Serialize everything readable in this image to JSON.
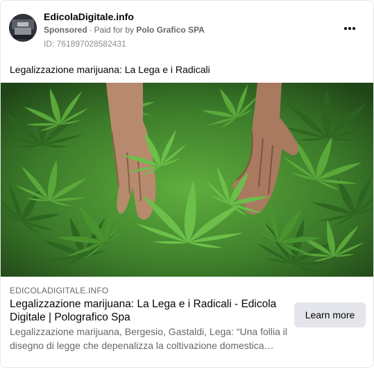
{
  "post": {
    "page_name": "EdicolaDigitale.info",
    "sponsored_label": "Sponsored",
    "paid_for_prefix": "Paid for by",
    "paid_for_by": "Polo Grafico SPA",
    "ad_id": "ID: 761897028582431",
    "body_text": "Legalizzazione marijuana: La Lega e i Radicali",
    "more_icon": "more-dots-icon"
  },
  "link_preview": {
    "domain": "EDICOLADIGITALE.INFO",
    "title": "Legalizzazione marijuana: La Lega e i Radicali - Edicola Digitale | Polografico Spa",
    "description": "Legalizzazione marijuana, Bergesio, Gastaldi, Lega: “Una follia il disegno di legge che depenalizza la coltivazione domestica dell…",
    "cta_label": "Learn more"
  },
  "colors": {
    "secondary_text": "#65676b",
    "button_bg": "#e4e6eb",
    "leaf_green": "#4f9a35"
  }
}
